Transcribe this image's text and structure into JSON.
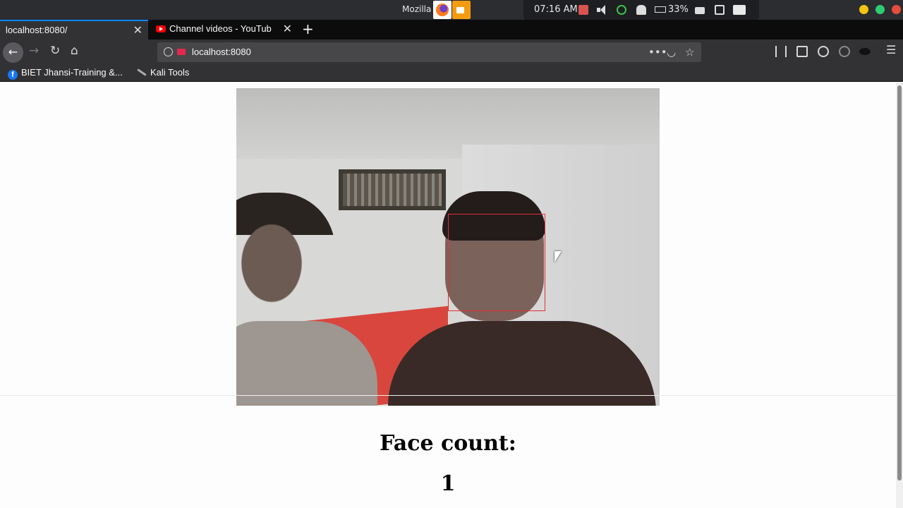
{
  "os": {
    "app_title": "Mozilla F",
    "time": "07:16 AM",
    "battery": "33%"
  },
  "tabs": [
    {
      "label": "localhost:8080/",
      "active": true
    },
    {
      "label": "Channel videos - YouTub",
      "active": false
    }
  ],
  "nav": {
    "url": "localhost:8080"
  },
  "bookmarks": [
    {
      "label": "BIET Jhansi-Training &..."
    },
    {
      "label": "Kali Tools"
    }
  ],
  "page": {
    "count_label": "Face count:",
    "count_value": "1"
  },
  "colors": {
    "face_box": "#e0303a",
    "active_tab_accent": "#0a84ff"
  }
}
